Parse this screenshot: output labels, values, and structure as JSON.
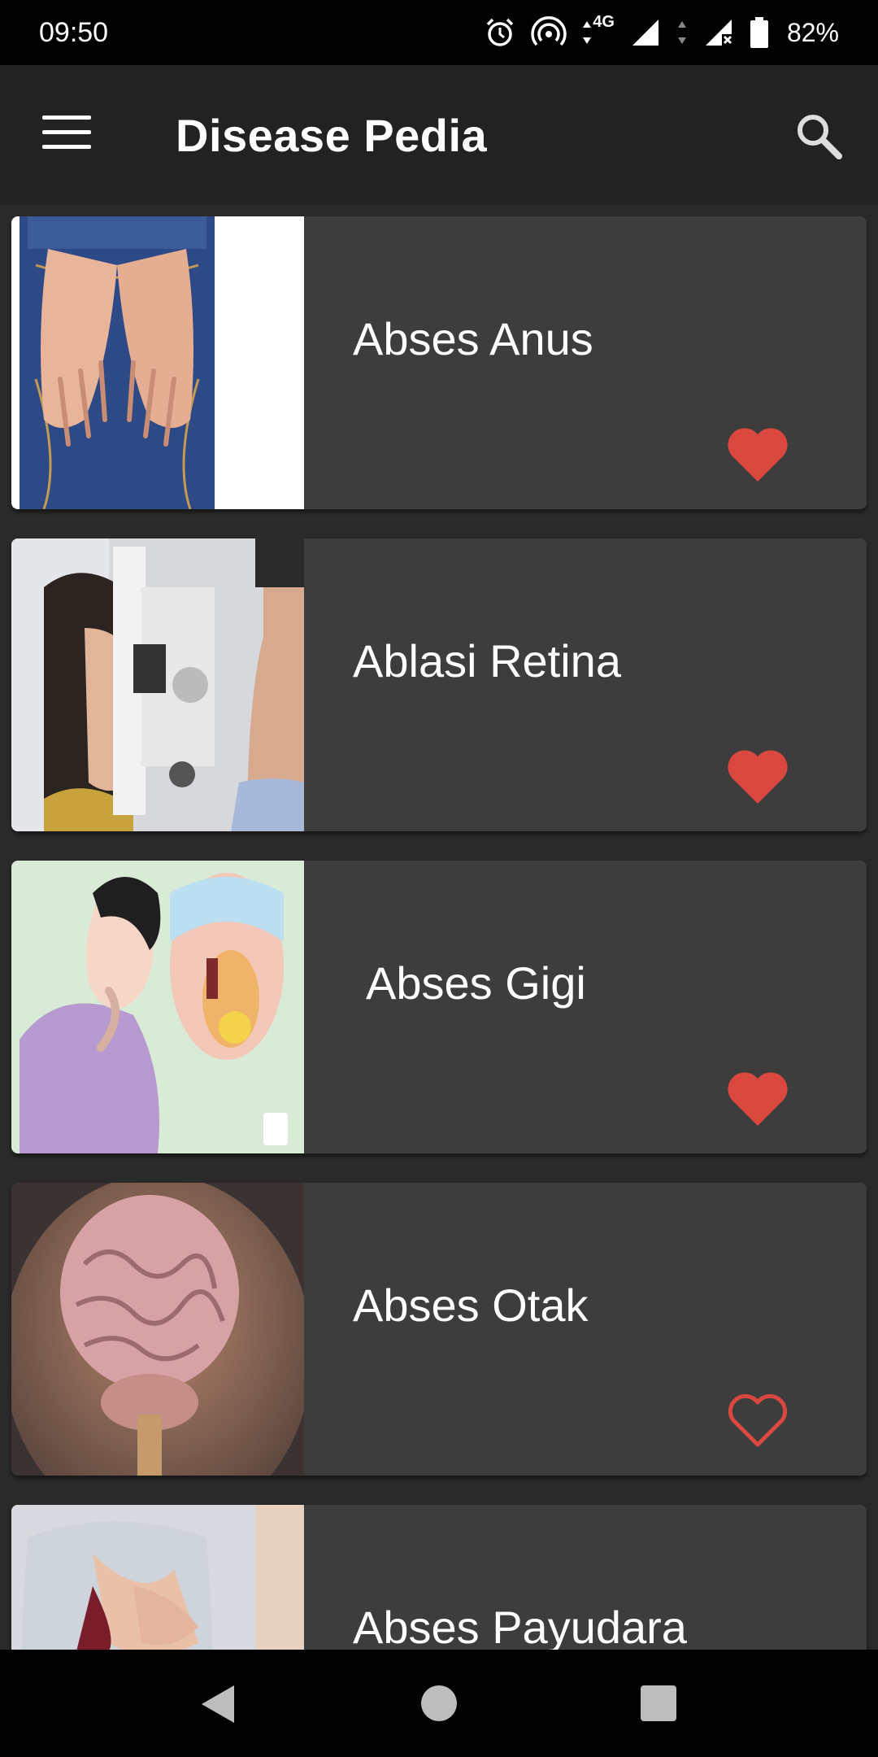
{
  "status_bar": {
    "time": "09:50",
    "network_label": "4G",
    "battery": "82%",
    "icons": [
      "alarm-icon",
      "hotspot-icon",
      "data-arrows-icon",
      "signal-icon",
      "signal-no-sim-icon",
      "battery-icon"
    ]
  },
  "app_bar": {
    "title": "Disease Pedia",
    "menu_icon": "hamburger-menu-icon",
    "search_icon": "search-icon"
  },
  "diseases": [
    {
      "name": "Abses Anus",
      "favorite": true,
      "image": "jeans-hands-photo"
    },
    {
      "name": "Ablasi Retina",
      "favorite": true,
      "image": "eye-exam-photo"
    },
    {
      "name": "Abses Gigi",
      "favorite": true,
      "image": "tooth-abscess-illustration"
    },
    {
      "name": "Abses Otak",
      "favorite": false,
      "image": "brain-illustration"
    },
    {
      "name": "Abses Payudara",
      "favorite": false,
      "image": "chest-pain-photo"
    }
  ],
  "colors": {
    "background": "#2a2a2a",
    "app_bar": "#222222",
    "card": "#3d3d3d",
    "heart": "#d9473f"
  },
  "nav_bar": {
    "icons": [
      "back-icon",
      "home-icon",
      "recents-icon"
    ]
  }
}
